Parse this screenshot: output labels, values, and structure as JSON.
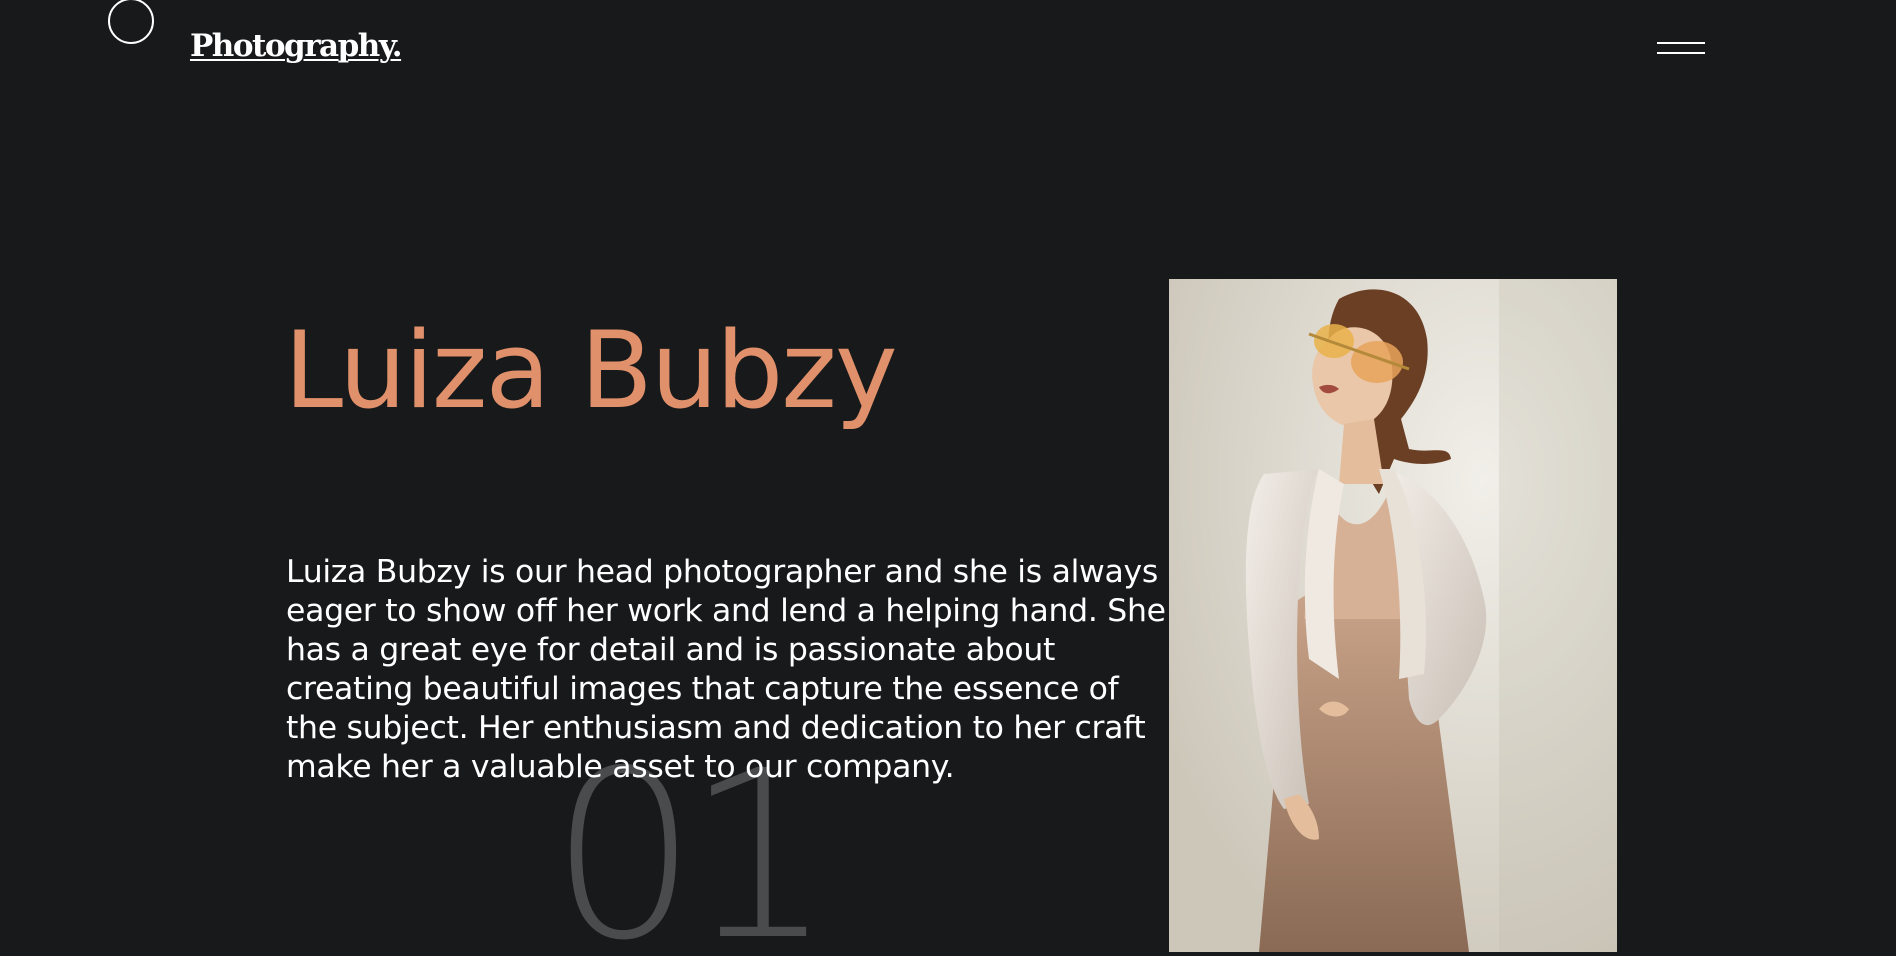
{
  "header": {
    "logo_text": "Photography.",
    "menu_icon": "hamburger-menu-icon",
    "cursor_icon": "cursor-circle-icon"
  },
  "profile": {
    "name": "Luiza Bubzy",
    "bio": "Luiza Bubzy is our head photographer and she is always eager to show off her work and lend a helping hand. She has a great eye for detail and is passionate about creating beautiful images that capture the essence of the subject. Her enthusiasm and dedication to her craft make her a valuable asset to our company.",
    "index": "01"
  },
  "colors": {
    "background": "#18191b",
    "accent": "#e0906a",
    "text": "#ffffff",
    "index_number": "#4a4b4d"
  }
}
